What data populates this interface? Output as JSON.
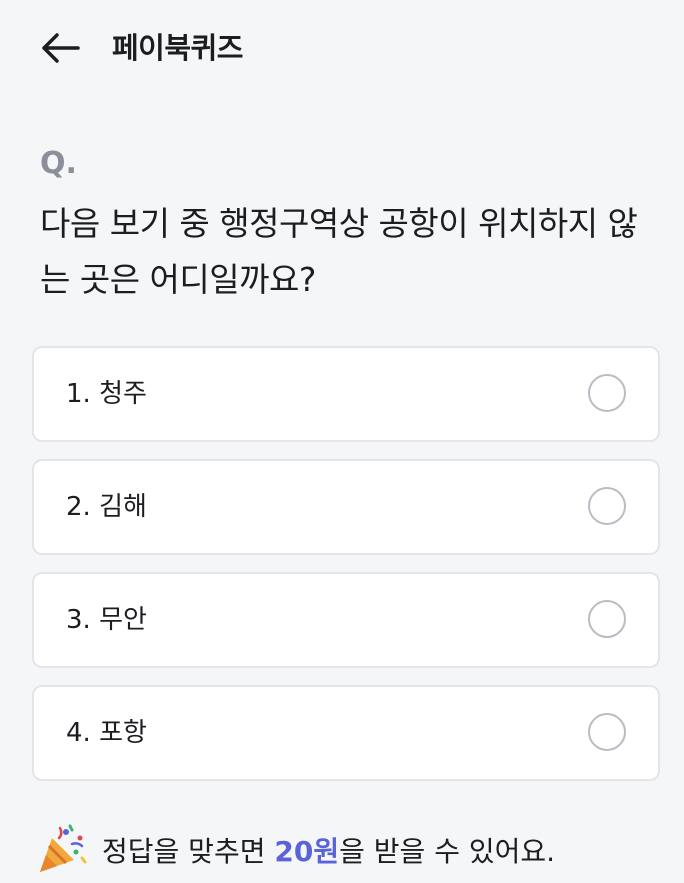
{
  "header": {
    "title": "페이북퀴즈",
    "back_icon": "arrow-left-icon"
  },
  "quiz": {
    "q_label": "Q.",
    "question": "다음 보기 중 행정구역상 공항이 위치하지 않는 곳은 어디일까요?",
    "options": [
      {
        "label": "1. 청주"
      },
      {
        "label": "2. 김해"
      },
      {
        "label": "3. 무안"
      },
      {
        "label": "4. 포항"
      }
    ]
  },
  "reward": {
    "icon": "party-popper-icon",
    "prefix": "정답을 맞추면 ",
    "amount": "20원",
    "suffix": "을 받을 수 있어요."
  },
  "colors": {
    "accent": "#5a63d8",
    "background": "#f5f6f8",
    "border": "#e3e5ea"
  }
}
